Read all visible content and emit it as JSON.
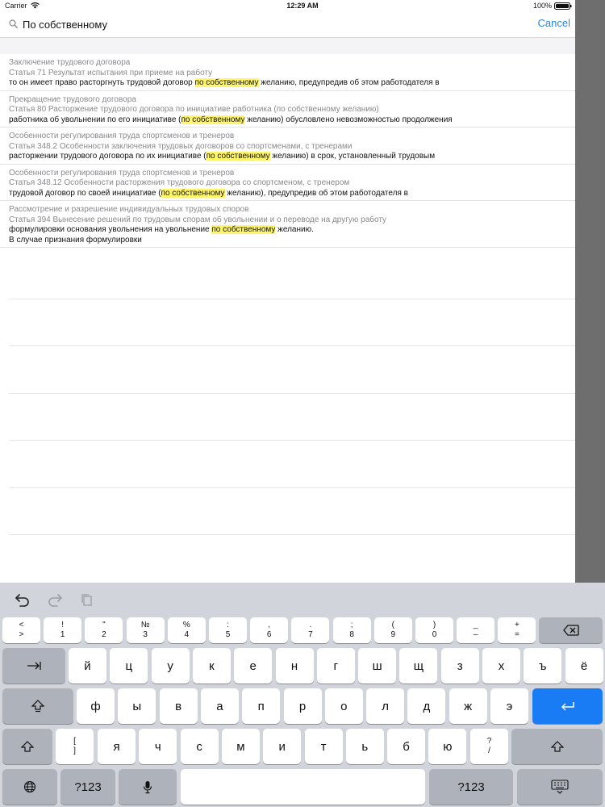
{
  "status_bar": {
    "carrier": "Carrier",
    "time": "12:29 AM",
    "battery": "100%"
  },
  "search": {
    "query": "По собственному",
    "cancel_label": "Cancel"
  },
  "results": [
    {
      "title": "Заключение трудового договора",
      "article": "Статья 71 Результат испытания при приеме на работу",
      "before": "то он имеет право расторгнуть трудовой договор ",
      "highlight": "по собственному",
      "after": " желанию, предупредив об этом работодателя в",
      "extra": ""
    },
    {
      "title": "Прекращение трудового договора",
      "article": "Статья 80 Расторжение трудового договора по инициативе работника (по собственному желанию)",
      "before": "работника об увольнении по его инициативе (",
      "highlight": "по собственному",
      "after": " желанию) обусловлено невозможностью продолжения",
      "extra": ""
    },
    {
      "title": "Особенности регулирования труда спортсменов и тренеров",
      "article": "Статья 348.2 Особенности заключения трудовых договоров со спортсменами, с тренерами",
      "before": "расторжении трудового договора по их инициативе (",
      "highlight": "по собственному",
      "after": " желанию) в срок, установленный трудовым",
      "extra": ""
    },
    {
      "title": "Особенности регулирования труда спортсменов и тренеров",
      "article": "Статья 348.12 Особенности расторжения трудового договора со спортсменом, с тренером",
      "before": "трудовой договор по своей инициативе (",
      "highlight": "по собственному",
      "after": " желанию), предупредив об этом работодателя в",
      "extra": ""
    },
    {
      "title": "Рассмотрение и разрешение индивидуальных трудовых споров",
      "article": "Статья 394 Вынесение решений по трудовым спорам об увольнении и о переводе на другую работу",
      "before": "формулировки основания увольнения на увольнение ",
      "highlight": "по собственному",
      "after": " желанию.",
      "extra": "В случае признания формулировки"
    }
  ],
  "keyboard": {
    "number_row": [
      {
        "top": "<",
        "bot": ">"
      },
      {
        "top": "!",
        "bot": "1"
      },
      {
        "top": "\"",
        "bot": "2"
      },
      {
        "top": "№",
        "bot": "3"
      },
      {
        "top": "%",
        "bot": "4"
      },
      {
        "top": ":",
        "bot": "5"
      },
      {
        "top": ",",
        "bot": "6"
      },
      {
        "top": ".",
        "bot": "7"
      },
      {
        "top": ";",
        "bot": "8"
      },
      {
        "top": "(",
        "bot": "9"
      },
      {
        "top": ")",
        "bot": "0"
      },
      {
        "top": "_",
        "bot": "–"
      },
      {
        "top": "+",
        "bot": "="
      }
    ],
    "row1": [
      "й",
      "ц",
      "у",
      "к",
      "е",
      "н",
      "г",
      "ш",
      "щ",
      "з",
      "х",
      "ъ",
      "ё"
    ],
    "row2": [
      "ф",
      "ы",
      "в",
      "а",
      "п",
      "р",
      "о",
      "л",
      "д",
      "ж",
      "э"
    ],
    "row3": [
      "я",
      "ч",
      "с",
      "м",
      "и",
      "т",
      "ь",
      "б",
      "ю"
    ],
    "bracket_key": {
      "top": "[",
      "bot": "]"
    },
    "slash_key": {
      "top": "?",
      "bot": "/"
    },
    "numbers_label": "?123"
  }
}
